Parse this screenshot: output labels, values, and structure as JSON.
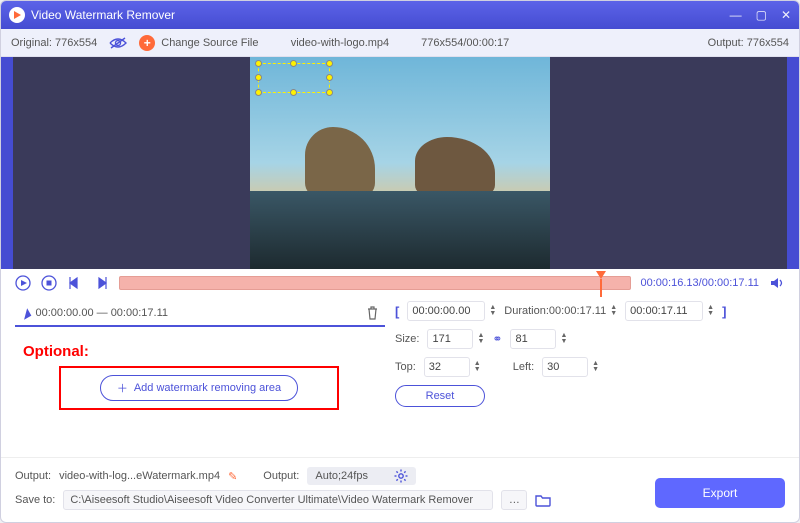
{
  "titlebar": {
    "app_name": "Video Watermark Remover"
  },
  "infobar": {
    "original_label": "Original:",
    "original_value": "776x554",
    "change_source": "Change Source File",
    "filename": "video-with-logo.mp4",
    "dims_time": "776x554/00:00:17",
    "output_label": "Output:",
    "output_value": "776x554"
  },
  "player": {
    "current": "00:00:16.13",
    "total": "00:00:17.11"
  },
  "segment": {
    "range": "00:00:00.00 — 00:00:17.11"
  },
  "optional_label": "Optional:",
  "add_area_label": "Add watermark removing area",
  "range": {
    "start": "00:00:00.00",
    "duration_label": "Duration:",
    "duration": "00:00:17.11",
    "end": "00:00:17.11"
  },
  "size": {
    "label": "Size:",
    "w": "171",
    "h": "81"
  },
  "pos": {
    "top_label": "Top:",
    "top": "32",
    "left_label": "Left:",
    "left": "30"
  },
  "reset_label": "Reset",
  "output": {
    "label": "Output:",
    "filename": "video-with-log...eWatermark.mp4",
    "fmt_label": "Output:",
    "fmt_value": "Auto;24fps"
  },
  "saveto": {
    "label": "Save to:",
    "path": "C:\\Aiseesoft Studio\\Aiseesoft Video Converter Ultimate\\Video Watermark Remover"
  },
  "export_label": "Export"
}
